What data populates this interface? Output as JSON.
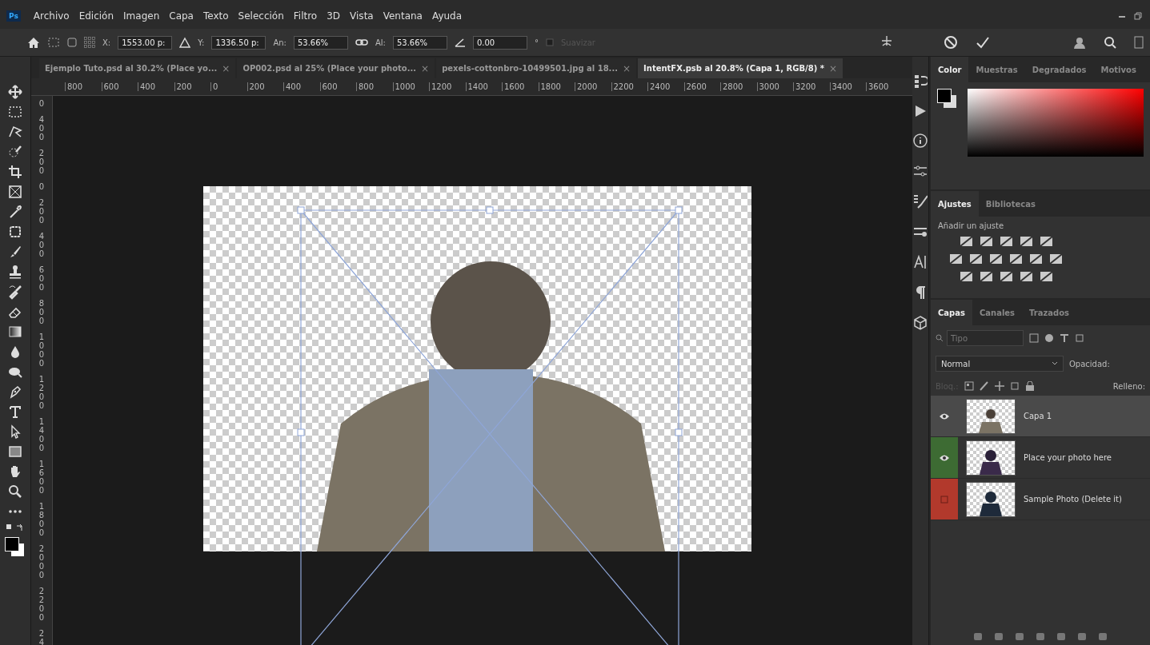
{
  "app_logo": "Ps",
  "menu": [
    "Archivo",
    "Edición",
    "Imagen",
    "Capa",
    "Texto",
    "Selección",
    "Filtro",
    "3D",
    "Vista",
    "Ventana",
    "Ayuda"
  ],
  "options": {
    "fields": [
      {
        "label": "X:",
        "value": "1553.00 p:"
      },
      {
        "label": "Y:",
        "value": "1336.50 p:"
      },
      {
        "label": "An:",
        "value": "53.66%"
      },
      {
        "label": "Al:",
        "value": "53.66%"
      },
      {
        "value": "0.00"
      }
    ],
    "degree": "°",
    "antialias": {
      "label": "Suavizar",
      "disabled": true
    }
  },
  "tabs": [
    {
      "label": "Ejemplo Tuto.psd al 30.2% (Place yo...",
      "selected": false
    },
    {
      "label": "OP002.psd al 25% (Place your photo...",
      "selected": false
    },
    {
      "label": "pexels-cottonbro-10499501.jpg al 18...",
      "selected": false
    },
    {
      "label": "IntentFX.psb al 20.8% (Capa 1, RGB/8) *",
      "selected": true
    }
  ],
  "tab_close": "×",
  "ruler_h": [
    "800",
    "600",
    "400",
    "200",
    "0",
    "200",
    "400",
    "600",
    "800",
    "1000",
    "1200",
    "1400",
    "1600",
    "1800",
    "2000",
    "2200",
    "2400",
    "2600",
    "2800",
    "3000",
    "3200",
    "3400",
    "3600"
  ],
  "ruler_v": [
    "0",
    "400",
    "200",
    "0",
    "200",
    "400",
    "600",
    "800",
    "1000",
    "1200",
    "1400",
    "1600",
    "1800",
    "2000",
    "2200",
    "24"
  ],
  "color_panel": {
    "tabs": [
      {
        "label": "Color",
        "selected": true
      },
      {
        "label": "Muestras",
        "selected": false
      },
      {
        "label": "Degradados",
        "selected": false
      },
      {
        "label": "Motivos",
        "selected": false
      }
    ]
  },
  "adjust_panel": {
    "tabs": [
      {
        "label": "Ajustes",
        "selected": true
      },
      {
        "label": "Bibliotecas",
        "selected": false
      }
    ],
    "hint": "Añadir un ajuste"
  },
  "layers_panel": {
    "tabs": [
      {
        "label": "Capas",
        "selected": true
      },
      {
        "label": "Canales",
        "selected": false
      },
      {
        "label": "Trazados",
        "selected": false
      }
    ],
    "filter_placeholder": "Tipo",
    "blend_mode": "Normal",
    "opacity_label": "Opacidad:",
    "lock_label": "Bloq.:",
    "fill_label": "Relleno:",
    "layers": [
      {
        "name": "Capa 1",
        "visible": true,
        "selected": true,
        "kind": "person"
      },
      {
        "name": "Place your photo here",
        "visible": true,
        "selected": false,
        "color": "#3d6b33",
        "kind": "silhouette"
      },
      {
        "name": "Sample Photo (Delete it)",
        "visible": false,
        "selected": false,
        "color": "#b2392c",
        "kind": "silhouette"
      }
    ]
  }
}
